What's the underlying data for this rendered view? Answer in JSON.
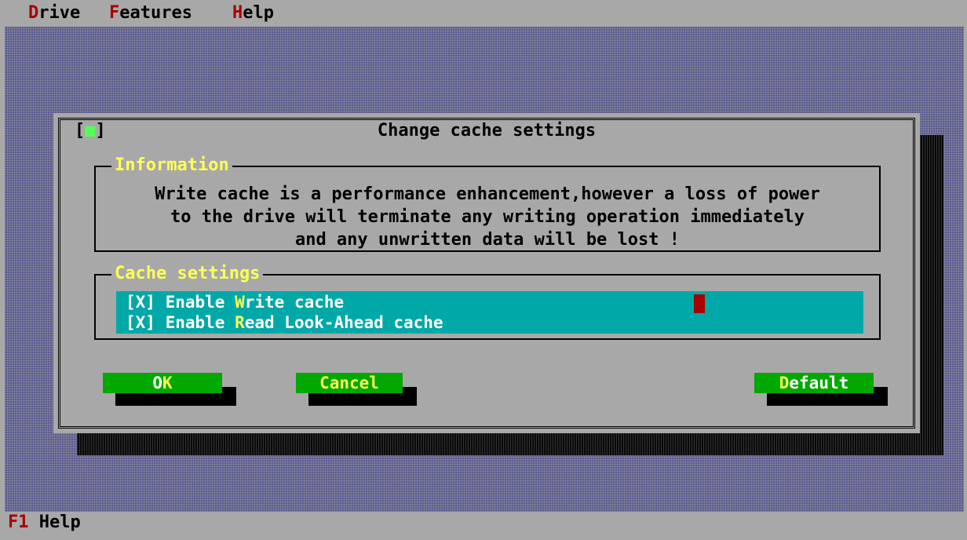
{
  "menubar": {
    "items": [
      {
        "hotkey": "D",
        "rest": "rive"
      },
      {
        "hotkey": "F",
        "rest": "eatures"
      },
      {
        "hotkey": "H",
        "rest": "elp"
      }
    ]
  },
  "dialog": {
    "title": "Change cache settings",
    "close_open": "[",
    "close_mark": "■",
    "close_close": "]",
    "info_group": {
      "label": "Information",
      "text": "Write cache is a performance enhancement,however a loss of power\nto the drive will terminate any writing operation immediately\nand any unwritten data will be lost !"
    },
    "cache_group": {
      "label": "Cache settings",
      "options": [
        {
          "prefix": "[X] Enable ",
          "hotkey": "W",
          "suffix": "rite cache",
          "checked": true
        },
        {
          "prefix": "[X] Enable ",
          "hotkey": "R",
          "suffix": "ead Look-Ahead cache",
          "checked": true
        }
      ]
    },
    "buttons": {
      "ok": {
        "hotkey": "O",
        "rest": "K"
      },
      "cancel": {
        "hotkey": "",
        "rest": "Cancel"
      },
      "default": {
        "hotkey": "D",
        "rest": "efault"
      }
    }
  },
  "statusbar": {
    "key": "F1",
    "label": " Help"
  },
  "colors": {
    "menu_hotkey": "#a80000",
    "group_label": "#ffff55",
    "button_bg": "#00a800",
    "list_bg": "#00a8a8",
    "desktop": "#5b5b8f"
  }
}
